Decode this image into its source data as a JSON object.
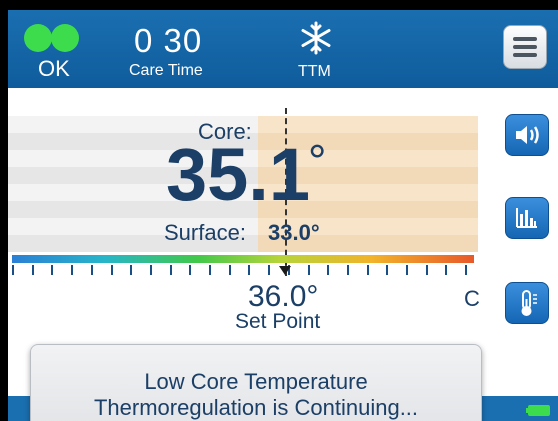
{
  "header": {
    "status": {
      "text": "OK",
      "color": "#3ddc4d"
    },
    "care_time": {
      "value": "0 30",
      "label": "Care Time"
    },
    "mode": {
      "icon": "snowflake-icon",
      "label": "TTM"
    },
    "menu": {
      "icon": "hamburger-menu-icon"
    }
  },
  "temperature": {
    "core_label": "Core:",
    "core_value": "35.1",
    "core_degree": "°",
    "surface_label": "Surface:",
    "surface_value": "33.0°"
  },
  "set_point": {
    "value": "36.0°",
    "label": "Set Point",
    "unit": "C"
  },
  "side_buttons": [
    {
      "icon": "speaker-volume-icon"
    },
    {
      "icon": "bar-chart-icon"
    },
    {
      "icon": "thermometer-icon"
    }
  ],
  "alert": {
    "line1": "Low Core Temperature",
    "line2": "Thermoregulation is Continuing..."
  },
  "colors": {
    "header_blue": "#1a6fb0",
    "text_navy": "#1b3f66",
    "ok_green": "#3ddc4d"
  }
}
